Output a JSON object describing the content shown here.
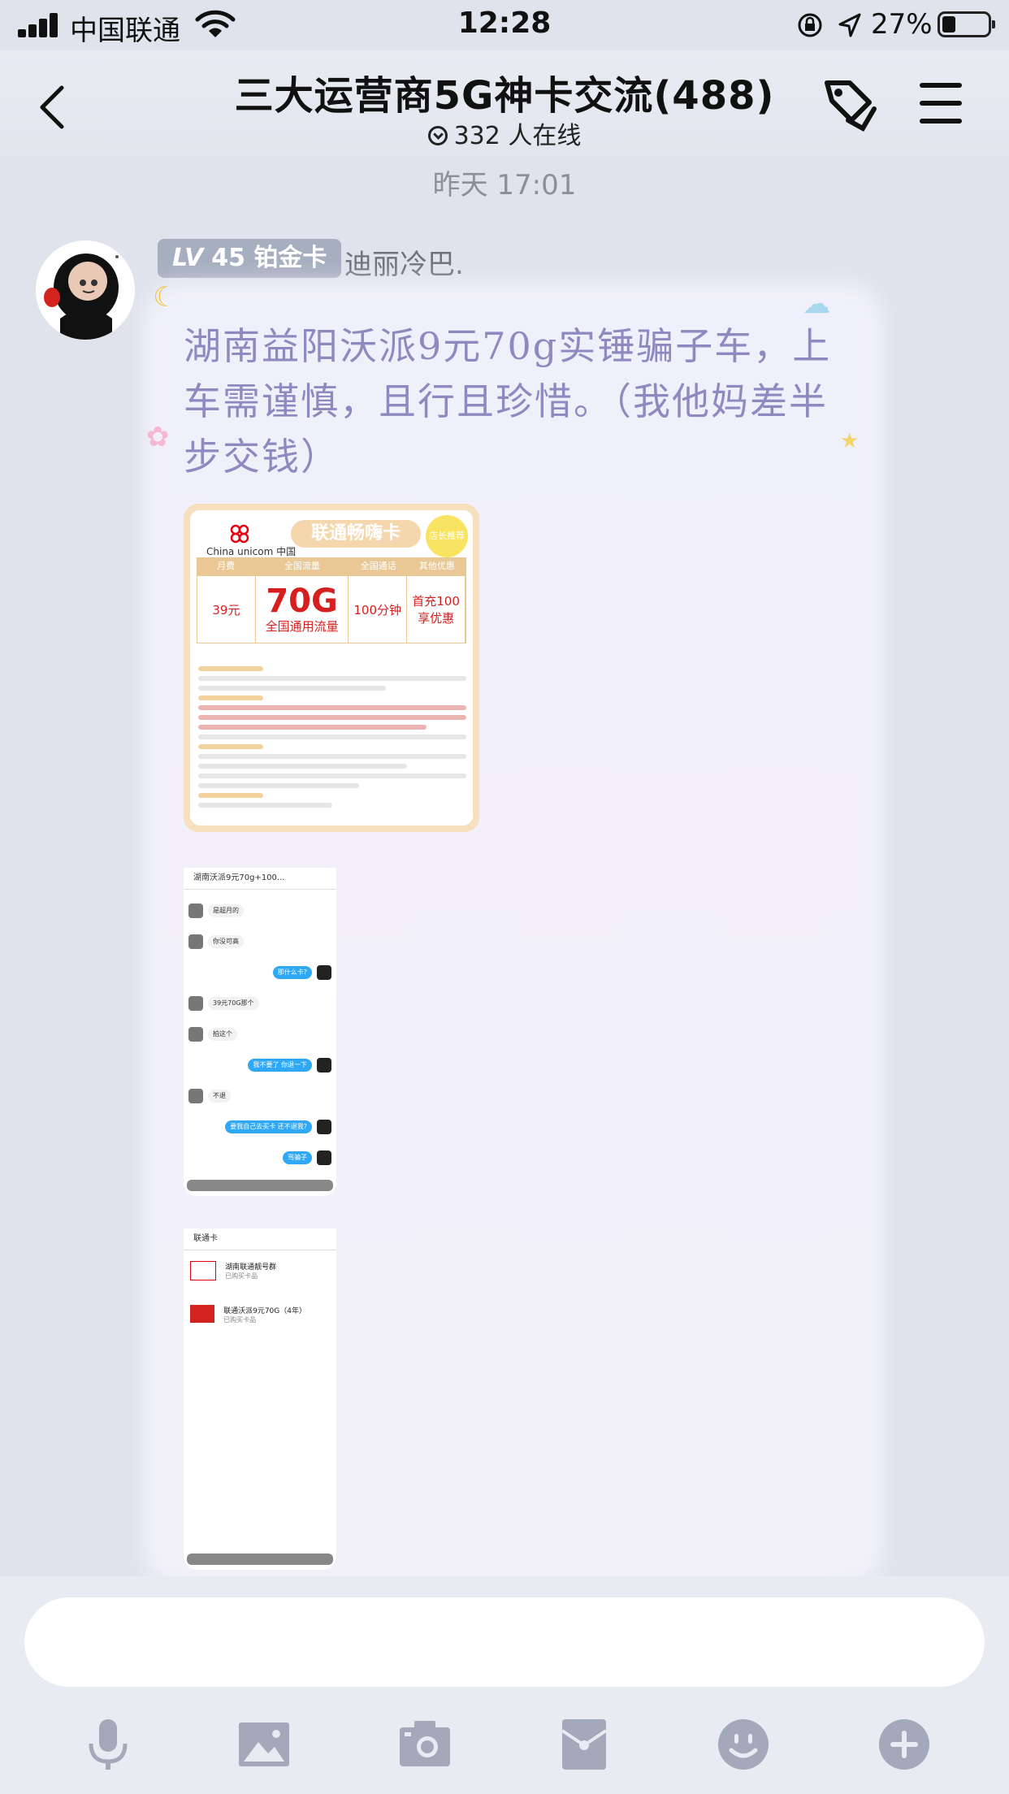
{
  "status_bar": {
    "carrier": "中国联通",
    "time": "12:28",
    "battery_text": "27%",
    "battery_level": 0.27
  },
  "header": {
    "title": "三大运营商5G神卡交流(488)",
    "online_text": "332 人在线"
  },
  "chat": {
    "timestamp": "昨天 17:01",
    "sender": {
      "level_prefix": "LV",
      "level_number": "45",
      "level_title": "铂金卡",
      "nickname": "迪丽冷巴."
    },
    "message_text": "湖南益阳沃派9元70g实锤骗子车，上车需谨慎，且行且珍惜。（我他妈差半步交钱）"
  },
  "card_image": {
    "brand_en": "China unicom",
    "brand_cn": "中国联通",
    "title": "联通畅嗨卡",
    "stamp": "店长推荐",
    "columns": [
      "月费",
      "全国流量",
      "全国通话",
      "其他优惠"
    ],
    "fee": "39元",
    "data": "70G",
    "data_sub": "全国通用流量",
    "calls": "100分钟",
    "promo": "首充100享优惠"
  },
  "screenshot1": {
    "title": "湖南沃派9元70g+100...",
    "messages": [
      {
        "side": "left",
        "text": "是超月的"
      },
      {
        "side": "left",
        "text": "你没可高"
      },
      {
        "side": "right",
        "text": "那什么卡?"
      },
      {
        "side": "left",
        "text": "39元70G那个"
      },
      {
        "side": "left",
        "text": "拍这个"
      },
      {
        "side": "right",
        "text": "我不要了 你退一下"
      },
      {
        "side": "left",
        "text": "不退"
      },
      {
        "side": "right",
        "text": "要我自己去买卡 还不退我?"
      },
      {
        "side": "right",
        "text": "骂骗子"
      }
    ]
  },
  "screenshot2": {
    "title": "联通卡",
    "items": [
      {
        "name": "湖南联通靓号群",
        "sub": "已购买卡品"
      },
      {
        "name": "联通沃派9元70G（4年）",
        "sub": "已购买卡品"
      }
    ]
  },
  "input": {
    "placeholder": ""
  },
  "toolbar": [
    "mic-icon",
    "image-icon",
    "camera-icon",
    "red-packet-icon",
    "emoji-icon",
    "plus-icon"
  ],
  "colors": {
    "accent": "#8e8abf",
    "badge": "#a6aec0",
    "icon": "#a3a9ba"
  }
}
